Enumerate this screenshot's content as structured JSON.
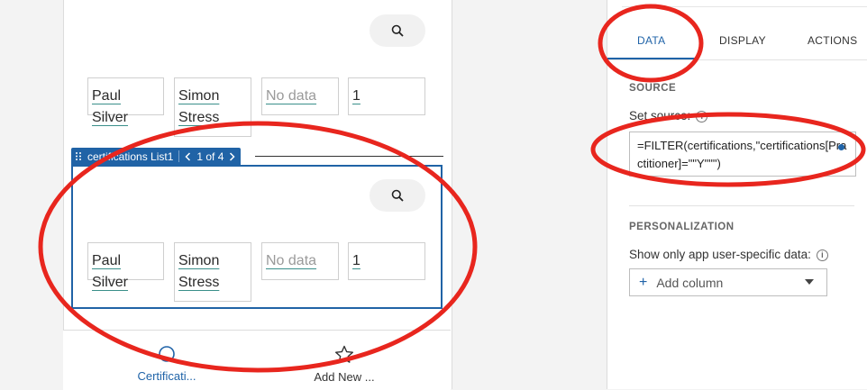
{
  "list_rows": [
    {
      "cells": [
        "Paul Silver",
        "Simon Stress",
        "No data",
        "1"
      ]
    },
    {
      "cells": [
        "Paul Silver",
        "Simon Stress",
        "No data",
        "1"
      ]
    }
  ],
  "selection": {
    "component_name": "certifications List1",
    "pager": "1 of 4"
  },
  "bottom_nav": {
    "items": [
      {
        "label": "Certificati...",
        "icon": "circle-icon",
        "active": true
      },
      {
        "label": "Add New ...",
        "icon": "star-icon",
        "active": false
      }
    ]
  },
  "panel": {
    "tabs": [
      {
        "label": "DATA",
        "active": true
      },
      {
        "label": "DISPLAY",
        "active": false
      },
      {
        "label": "ACTIONS",
        "active": false
      }
    ],
    "source_title": "SOURCE",
    "set_source_label": "Set source:",
    "formula": "=FILTER(certifications,\"certifications[Practitioner]=\"\"Y\"\"\")",
    "personalization_title": "PERSONALIZATION",
    "user_specific_label": "Show only app user-specific data:",
    "add_column_label": "Add column"
  },
  "colors": {
    "accent": "#1f63a8",
    "selection": "#2063a6",
    "annotation": "#e8261e",
    "underline": "#3a8f8a"
  }
}
